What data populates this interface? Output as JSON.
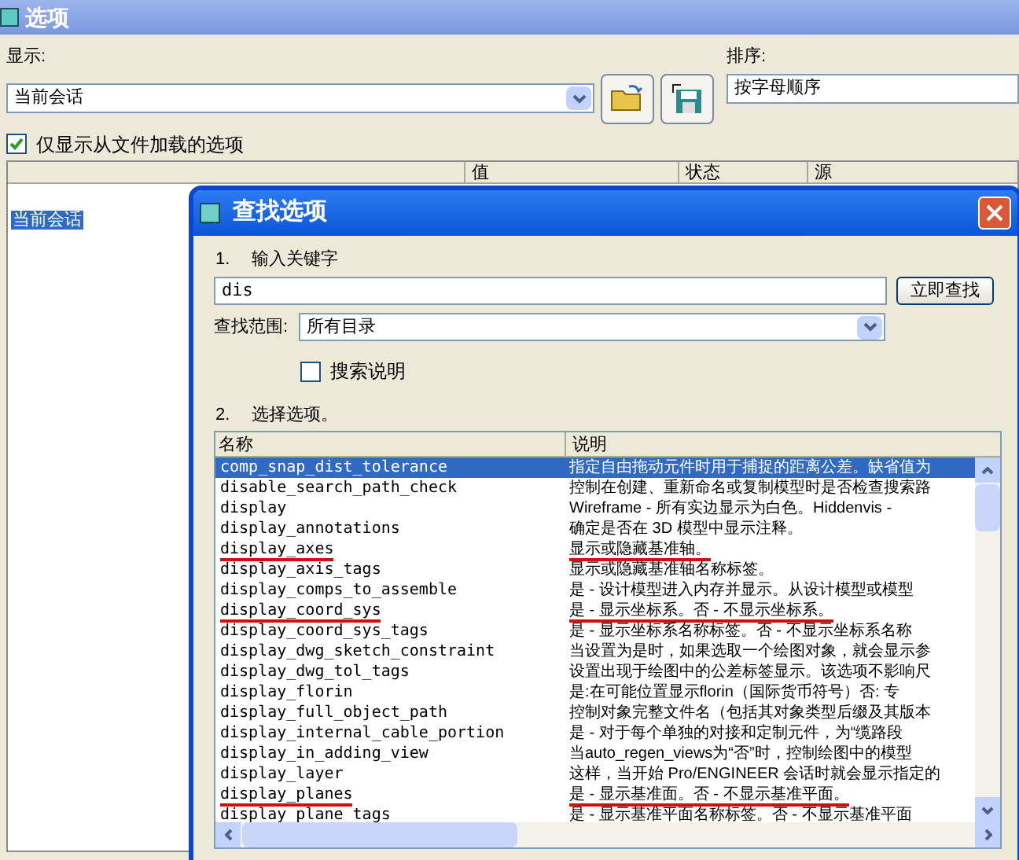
{
  "window": {
    "title": "选项"
  },
  "display": {
    "label": "显示:",
    "value": "当前会话"
  },
  "sort": {
    "label": "排序:",
    "value": "按字母顺序"
  },
  "only_loaded": {
    "label": "仅显示从文件加载的选项",
    "checked": true
  },
  "options_table": {
    "columns": [
      "值",
      "状态",
      "源"
    ],
    "tree": [
      {
        "label": "当前会话",
        "selected": true
      }
    ]
  },
  "dialog": {
    "title": "查找选项",
    "step1": "1.",
    "step1_label": "输入关键字",
    "keyword": "dis",
    "search_button": "立即查找",
    "scope_label": "查找范围:",
    "scope_value": "所有目录",
    "search_desc": {
      "label": "搜索说明",
      "checked": false
    },
    "step2": "2.",
    "step2_label": "选择选项。",
    "columns": [
      "名称",
      "说明"
    ],
    "rows": [
      {
        "name": "comp_snap_dist_tolerance",
        "desc": "指定自由拖动元件时用于捕捉的距离公差。缺省值为",
        "selected": true,
        "marked": false
      },
      {
        "name": "disable_search_path_check",
        "desc": "控制在创建、重新命名或复制模型时是否检查搜索路",
        "selected": false,
        "marked": false
      },
      {
        "name": "display",
        "desc": "Wireframe - 所有实边显示为白色。Hiddenvis -",
        "selected": false,
        "marked": false
      },
      {
        "name": "display_annotations",
        "desc": "确定是否在 3D 模型中显示注释。",
        "selected": false,
        "marked": false
      },
      {
        "name": "display_axes",
        "desc": "显示或隐藏基准轴。",
        "selected": false,
        "marked": true
      },
      {
        "name": "display_axis_tags",
        "desc": "显示或隐藏基准轴名称标签。",
        "selected": false,
        "marked": false
      },
      {
        "name": "display_comps_to_assemble",
        "desc": "是 - 设计模型进入内存并显示。从设计模型或模型",
        "selected": false,
        "marked": false
      },
      {
        "name": "display_coord_sys",
        "desc": "是 - 显示坐标系。否 - 不显示坐标系。",
        "selected": false,
        "marked": true
      },
      {
        "name": "display_coord_sys_tags",
        "desc": "是 - 显示坐标系名称标签。否 - 不显示坐标系名称",
        "selected": false,
        "marked": false
      },
      {
        "name": "display_dwg_sketch_constraint",
        "desc": "当设置为是时，如果选取一个绘图对象，就会显示参",
        "selected": false,
        "marked": false
      },
      {
        "name": "display_dwg_tol_tags",
        "desc": "设置出现于绘图中的公差标签显示。该选项不影响尺",
        "selected": false,
        "marked": false
      },
      {
        "name": "display_florin",
        "desc": "是:在可能位置显示florin（国际货币符号）否: 专",
        "selected": false,
        "marked": false
      },
      {
        "name": "display_full_object_path",
        "desc": "控制对象完整文件名（包括其对象类型后缀及其版本",
        "selected": false,
        "marked": false
      },
      {
        "name": "display_internal_cable_portion",
        "desc": "是 - 对于每个单独的对接和定制元件，为“缆路段",
        "selected": false,
        "marked": false
      },
      {
        "name": "display_in_adding_view",
        "desc": "当auto_regen_views为“否”时，控制绘图中的模型",
        "selected": false,
        "marked": false
      },
      {
        "name": "display_layer",
        "desc": "这样，当开始 Pro/ENGINEER 会话时就会显示指定的",
        "selected": false,
        "marked": false
      },
      {
        "name": "display_planes",
        "desc": "是 - 显示基准面。否 - 不显示基准平面。",
        "selected": false,
        "marked": true
      },
      {
        "name": "display_plane_tags",
        "desc": "是 - 显示基准平面名称标签。否 - 不显示基准平面",
        "selected": false,
        "marked": false
      }
    ]
  }
}
